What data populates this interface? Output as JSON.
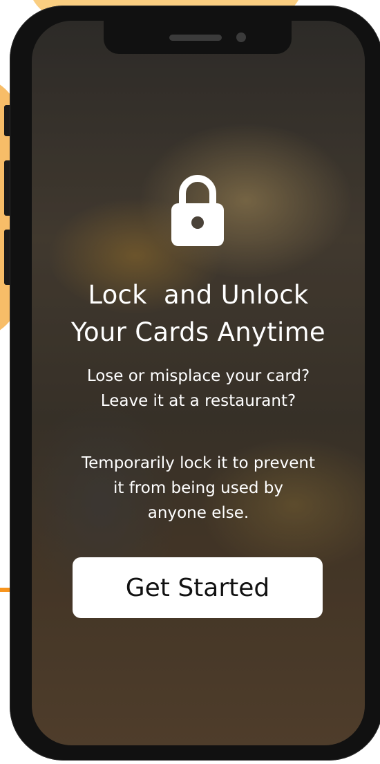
{
  "colors": {
    "accent_orange": "#f7941d",
    "decor_yellow": "#f7b955",
    "phone_frame": "#111111",
    "text_light": "#ffffff",
    "button_bg": "#ffffff",
    "button_text": "#111111"
  },
  "icons": {
    "hero": "lock-icon",
    "left_pointer": "arrow-right-icon",
    "right_marker": "dot-pointer-icon"
  },
  "onboarding": {
    "title_line1": "Lock  and Unlock",
    "title_line2": "Your Cards Anytime",
    "body1_line1": "Lose or misplace your card?",
    "body1_line2": "Leave it at a restaurant?",
    "body2_line1": "Temporarily lock it to prevent",
    "body2_line2": "it from being used by",
    "body2_line3": "anyone else.",
    "cta_label": "Get Started"
  }
}
